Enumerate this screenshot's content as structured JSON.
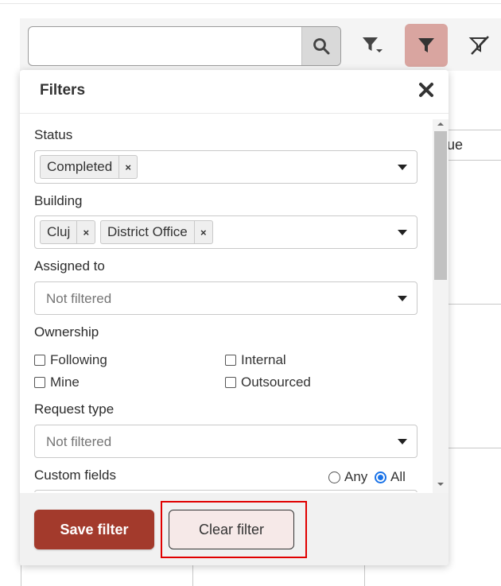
{
  "search": {
    "placeholder": "",
    "value": ""
  },
  "toolbar": {
    "search_icon": "search-icon",
    "filter_options_icon": "filter-dropdown-icon",
    "filter_icon": "filter-icon",
    "clear_filter_icon": "filter-clear-icon",
    "active_color": "#d9a5a0"
  },
  "table": {
    "partial_header": "ue"
  },
  "panel": {
    "title": "Filters",
    "close_icon": "close-icon",
    "status": {
      "label": "Status",
      "tags": [
        "Completed"
      ]
    },
    "building": {
      "label": "Building",
      "tags": [
        "Cluj",
        "District Office"
      ]
    },
    "assigned_to": {
      "label": "Assigned to",
      "placeholder": "Not filtered"
    },
    "ownership": {
      "label": "Ownership",
      "options": [
        {
          "label": "Following",
          "checked": false
        },
        {
          "label": "Internal",
          "checked": false
        },
        {
          "label": "Mine",
          "checked": false
        },
        {
          "label": "Outsourced",
          "checked": false
        }
      ]
    },
    "request_type": {
      "label": "Request type",
      "placeholder": "Not filtered"
    },
    "custom_fields": {
      "label": "Custom fields",
      "match_options": [
        {
          "label": "Any",
          "selected": false
        },
        {
          "label": "All",
          "selected": true
        }
      ]
    },
    "footer": {
      "save_label": "Save filter",
      "clear_label": "Clear filter",
      "save_color": "#a33a2c",
      "highlight_color": "#e00000"
    }
  }
}
